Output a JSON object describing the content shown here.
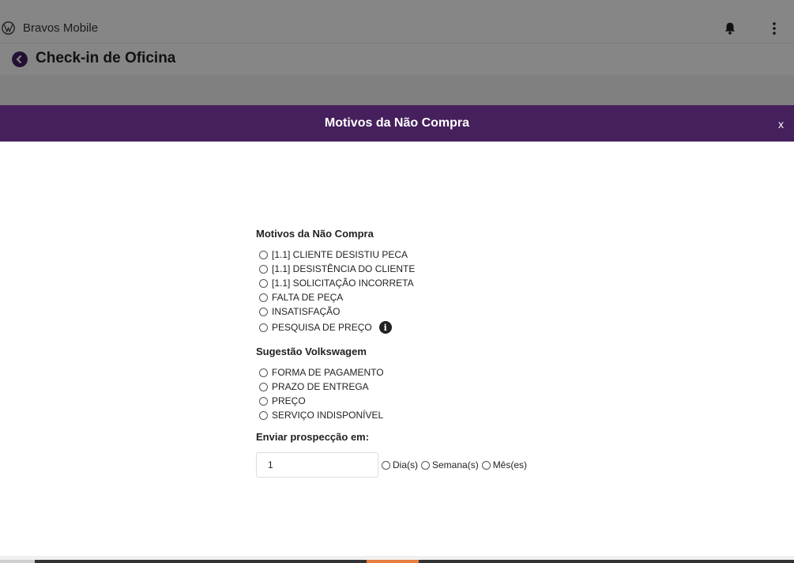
{
  "app": {
    "name": "Bravos Mobile"
  },
  "page": {
    "title": "Check-in de Oficina"
  },
  "modal": {
    "title": "Motivos da Não Compra",
    "close_label": "x",
    "sections": {
      "motivos": {
        "title": "Motivos da Não Compra",
        "options": [
          "[1.1] CLIENTE DESISTIU PECA",
          "[1.1] DESISTÊNCIA DO CLIENTE",
          "[1.1] SOLICITAÇÃO INCORRETA",
          "FALTA DE PEÇA",
          "INSATISFAÇÃO",
          "PESQUISA DE PREÇO"
        ],
        "info_icon_glyph": "i"
      },
      "sugestao": {
        "title": "Sugestão Volkswagem",
        "options": [
          "FORMA DE PAGAMENTO",
          "PRAZO DE ENTREGA",
          "PREÇO",
          "SERVIÇO INDISPONÍVEL"
        ]
      },
      "prospeccao": {
        "title": "Enviar prospecção em:",
        "quantity_value": "1",
        "periods": [
          "Dia(s)",
          "Semana(s)",
          "Mês(es)"
        ]
      }
    }
  },
  "colors": {
    "brand_purple": "#45205c",
    "back_button": "#3f1f5b"
  },
  "icons": [
    "vw-logo-icon",
    "bell-icon",
    "more-vert-icon",
    "back-arrow-icon",
    "info-icon"
  ]
}
